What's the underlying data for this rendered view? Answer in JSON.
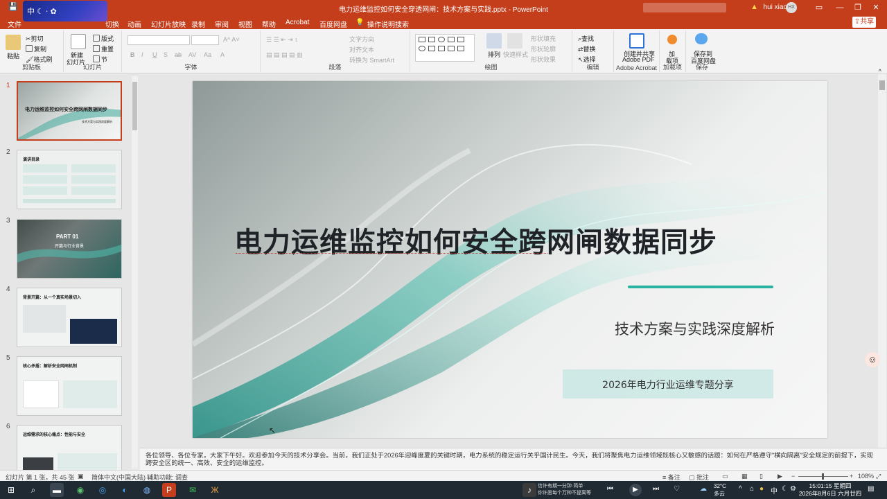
{
  "titlebar": {
    "title": "电力运维监控如何安全穿透网闸：技术方案与实践.pptx  -  PowerPoint",
    "user": "hui xiao",
    "user_initials": "HX",
    "ime_label": "中",
    "minimize": "—",
    "restore": "❐",
    "close": "✕",
    "ribbon_collapse": "▭"
  },
  "menu": {
    "file": "文件",
    "switch": "切换",
    "animation": "动画",
    "slideshow": "幻灯片放映",
    "record": "录制",
    "review": "审阅",
    "view": "视图",
    "help": "帮助",
    "acrobat": "Acrobat",
    "baidu": "百度网盘",
    "tell_me": "操作说明搜索",
    "share": "共享"
  },
  "ribbon": {
    "clipboard": {
      "paste": "粘贴",
      "cut": "剪切",
      "copy": "复制",
      "format_painter": "格式刷",
      "label": "剪贴板"
    },
    "slides": {
      "new_slide": "新建",
      "new_slide2": "幻灯片",
      "layout": "版式",
      "reset": "重置",
      "section": "节",
      "label": "幻灯片"
    },
    "font": {
      "label": "字体"
    },
    "paragraph": {
      "text_direction": "文字方向",
      "align_text": "对齐文本",
      "smartart": "转换为 SmartArt",
      "label": "段落"
    },
    "drawing": {
      "arrange": "排列",
      "quick_styles": "快速样式",
      "shape_fill": "形状填充",
      "shape_outline": "形状轮廓",
      "shape_effects": "形状效果",
      "label": "绘图"
    },
    "editing": {
      "find": "查找",
      "replace": "替换",
      "select": "选择",
      "label": "编辑"
    },
    "acrobat": {
      "create_share": "创建并共享",
      "adobe_pdf": "Adobe PDF",
      "label": "Adobe Acrobat"
    },
    "addins": {
      "add": "加",
      "addin": "载项",
      "label": "加载项"
    },
    "save": {
      "save_to": "保存到",
      "baidu": "百度网盘",
      "label": "保存"
    }
  },
  "thumbnails": [
    {
      "num": "1",
      "title": "电力运维监控如何安全跨网闸数据同步",
      "subtitle": "技术方案与实践深度解析"
    },
    {
      "num": "2",
      "title": "演讲目录"
    },
    {
      "num": "3",
      "title": "PART 01",
      "subtitle": "开篇与行业背景"
    },
    {
      "num": "4",
      "title": "背景开篇：从一个真实场景切入"
    },
    {
      "num": "5",
      "title": "核心矛盾：解析安全网闸机制"
    },
    {
      "num": "6",
      "title": "运维需求的核心痛点：性能与安全"
    }
  ],
  "slide": {
    "title": "电力运维监控如何安全跨网闸数据同步",
    "subtitle": "技术方案与实践深度解析",
    "tag": "2026年电力行业运维专题分享"
  },
  "notes": {
    "text": "各位领导、各位专家，大家下午好。欢迎参加今天的技术分享会。当前，我们正处于2026年迎峰度夏的关键时期，电力系统的稳定运行关乎国计民生。今天，我们将聚焦电力运维领域既核心又敏感的话题：如何在严格遵守\"横向隔离\"安全规定的前提下，实现跨安全区的统一、高效、安全的运维监控。"
  },
  "status": {
    "slide_info": "幻灯片 第 1 张，共 45 张",
    "language": "简体中文(中国大陆)",
    "accessibility": "辅助功能: 调查",
    "notes": "备注",
    "comments": "批注",
    "zoom": "108%"
  },
  "taskbar": {
    "time": "15:01:15 星期四",
    "date": "2026年8月6日 六月廿四",
    "temperature": "32°C",
    "weather": "多云",
    "media_title": "信许有期一分钟·简单",
    "media_sub": "你许愿每个万种不提离等",
    "ime": "中"
  }
}
